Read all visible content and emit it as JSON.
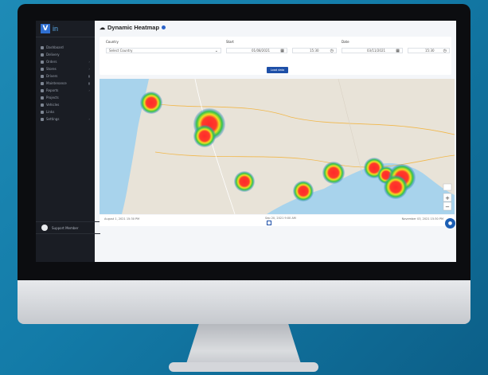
{
  "app": {
    "logo_letter": "V",
    "logo_text": "in",
    "page_title": "Dynamic Heatmap"
  },
  "sidebar": {
    "items": [
      {
        "label": "Dashboard",
        "chevron": ""
      },
      {
        "label": "Delivery",
        "chevron": ""
      },
      {
        "label": "Orders",
        "chevron": "›"
      },
      {
        "label": "Stores",
        "chevron": "›"
      },
      {
        "label": "Drivers",
        "chevron": "▮"
      },
      {
        "label": "Maintenance",
        "chevron": "▮"
      },
      {
        "label": "Reports",
        "chevron": "›"
      },
      {
        "label": "Projects",
        "chevron": ""
      },
      {
        "label": "Vehicles",
        "chevron": ""
      },
      {
        "label": "Links",
        "chevron": ""
      },
      {
        "label": "Settings",
        "chevron": "›"
      }
    ],
    "support_label": "Support Member"
  },
  "filters": {
    "country_label": "Country",
    "country_value": "Select Country",
    "start_label": "Start",
    "start_date": "01/08/2021",
    "start_time": "15:30",
    "end_label": "Date",
    "end_date": "03/11/2021",
    "end_time": "15:30",
    "load_label": "Load data"
  },
  "map_footer": {
    "left": "August 1, 2021 15:30 PM",
    "center": "Sep 20, 2021 9:00 AM",
    "right": "November 03, 2021 15:30 PM"
  },
  "colors": {
    "accent": "#1d4fa8",
    "sidebar_bg": "#1a1d24",
    "sea": "#a8d3ec",
    "land": "#e9e4da"
  },
  "icons": [
    "calendar-icon",
    "clock-icon",
    "chat-icon",
    "zoom-in-icon",
    "zoom-out-icon",
    "info-icon"
  ]
}
